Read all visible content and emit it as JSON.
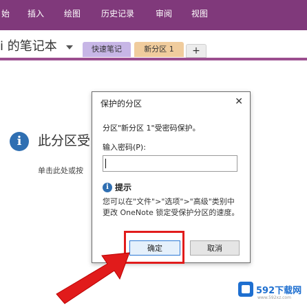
{
  "ribbon": {
    "tabs": [
      "始",
      "插入",
      "绘图",
      "历史记录",
      "审阅",
      "视图"
    ]
  },
  "notebook": {
    "title": "i 的笔记本"
  },
  "section_tabs": [
    {
      "label": "快速笔记"
    },
    {
      "label": "新分区 1"
    },
    {
      "label": "+"
    }
  ],
  "page": {
    "protected_message": "此分区受",
    "unlock_hint": "单击此处或按"
  },
  "dialog": {
    "title": "保护的分区",
    "message": "分区\"新分区 1\"受密码保护。",
    "password_label": "输入密码(P):",
    "password_value": "",
    "tip_label": "提示",
    "tip_text": "您可以在\"文件\">\"选项\">\"高级\"类别中更改 OneNote 锁定受保护分区的速度。",
    "ok_label": "确定",
    "cancel_label": "取消"
  },
  "watermark": {
    "text": "592下载网",
    "sub": "www.592xz.com"
  },
  "colors": {
    "ribbon": "#80397b",
    "highlight": "#e11b1b"
  }
}
